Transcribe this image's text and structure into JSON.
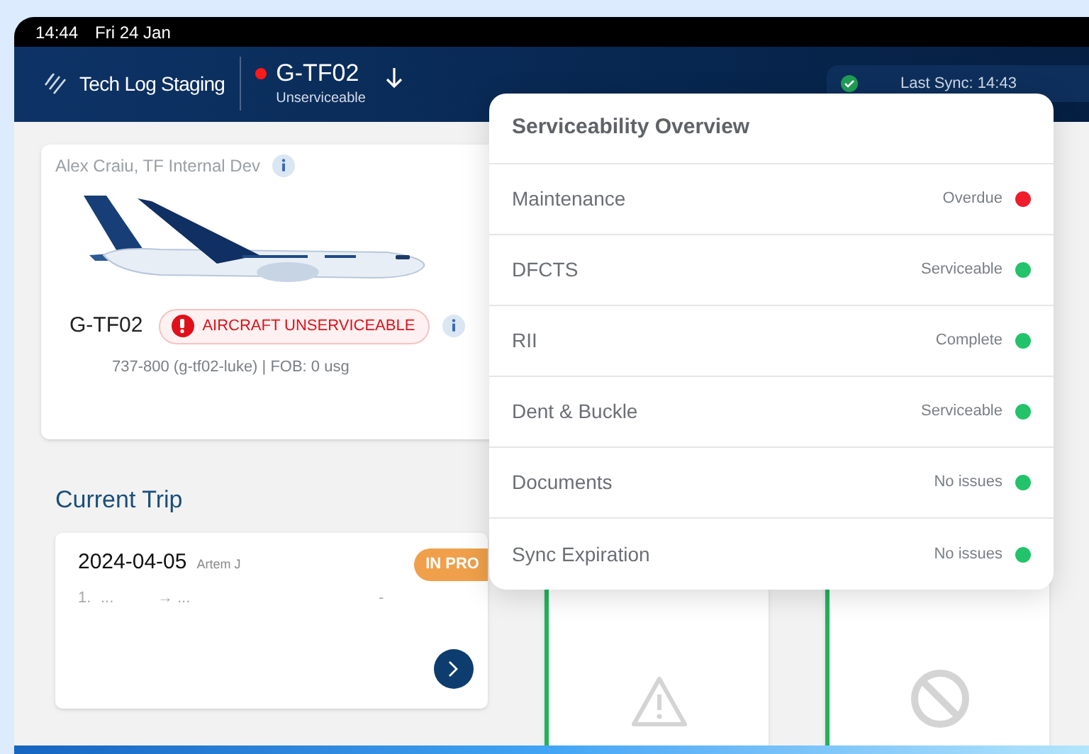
{
  "status_bar": {
    "time": "14:44",
    "date": "Fri 24 Jan"
  },
  "header": {
    "app_name": "Tech Log Staging",
    "aircraft": {
      "registration": "G-TF02",
      "status": "Unserviceable",
      "serviceable": false
    },
    "sync": {
      "label": "Last Sync: 14:43",
      "ok": true
    }
  },
  "aircraft_card": {
    "owner": "Alex Craiu, TF Internal Dev",
    "registration": "G-TF02",
    "badge": "AIRCRAFT UNSERVICEABLE",
    "details": "737-800 (g-tf02-luke) | FOB: 0 usg"
  },
  "current_trip": {
    "title": "Current Trip",
    "date": "2024-04-05",
    "crew": "Artem J",
    "status": "IN PRO",
    "leg": {
      "number": "1.",
      "from": "...",
      "arrow": "→",
      "to": "...",
      "time": "-"
    }
  },
  "tiles": [
    {
      "kind": "warning"
    },
    {
      "kind": "blocked"
    }
  ],
  "popover": {
    "title": "Serviceability Overview",
    "items": [
      {
        "label": "Maintenance",
        "status": "Overdue",
        "color": "#ef1c2c"
      },
      {
        "label": "DFCTS",
        "status": "Serviceable",
        "color": "#22c36a"
      },
      {
        "label": "RII",
        "status": "Complete",
        "color": "#22c36a"
      },
      {
        "label": "Dent & Buckle",
        "status": "Serviceable",
        "color": "#22c36a"
      },
      {
        "label": "Documents",
        "status": "No issues",
        "color": "#22c36a"
      },
      {
        "label": "Sync Expiration",
        "status": "No issues",
        "color": "#22c36a"
      }
    ]
  }
}
